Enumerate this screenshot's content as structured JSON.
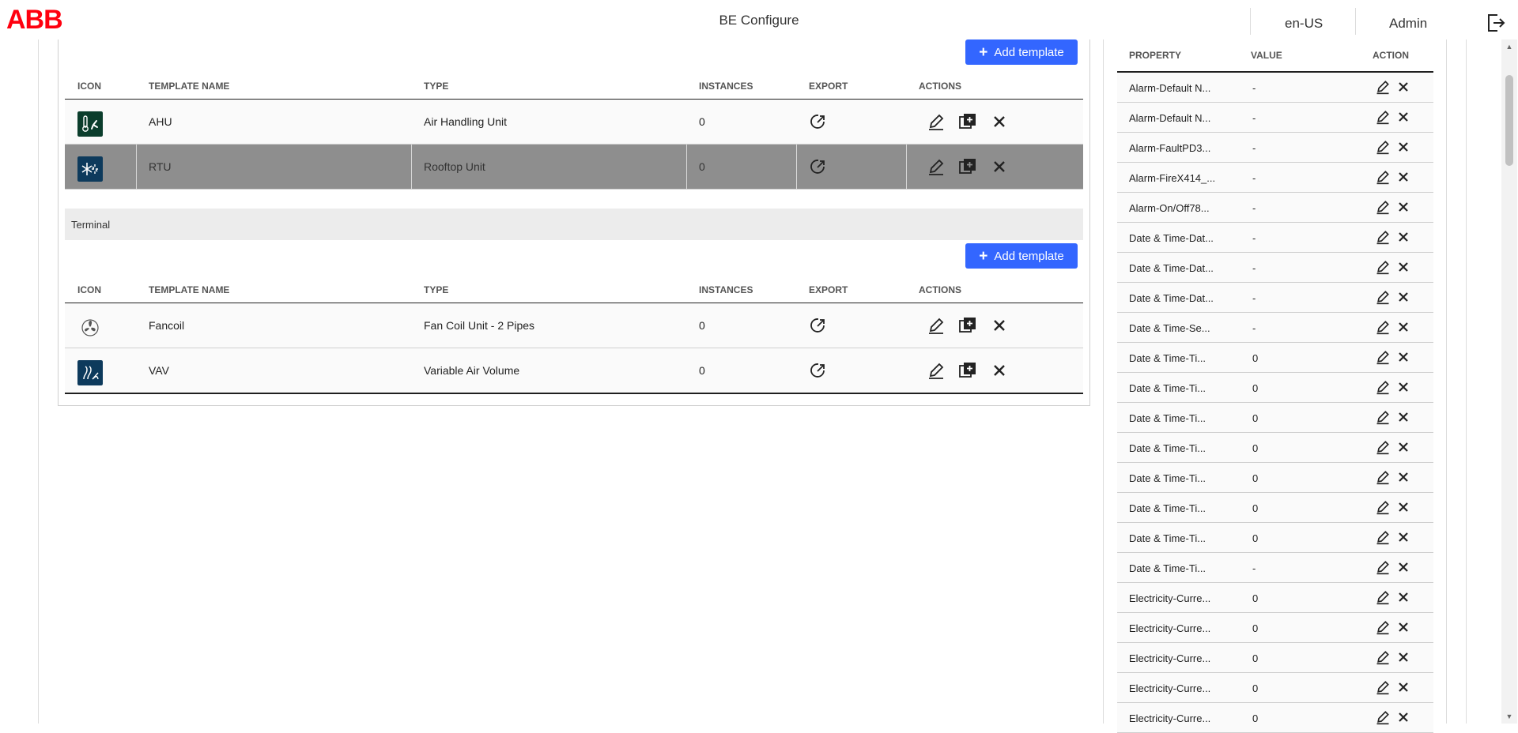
{
  "header": {
    "brand": "ABB",
    "app_title": "BE Configure",
    "language": "en-US",
    "user": "Admin"
  },
  "main": {
    "add_template_label": "Add template",
    "columns": {
      "icon": "ICON",
      "template_name": "TEMPLATE NAME",
      "type": "TYPE",
      "instances": "INSTANCES",
      "export": "EXPORT",
      "actions": "ACTIONS"
    },
    "groups": [
      {
        "name": "",
        "rows": [
          {
            "name": "AHU",
            "type": "Air Handling Unit",
            "instances": "0",
            "icon": "ahu-thermometer-fan-icon",
            "icon_color": "#0b3d2c",
            "selected": false
          },
          {
            "name": "RTU",
            "type": "Rooftop Unit",
            "instances": "0",
            "icon": "rtu-snowflake-sun-icon",
            "icon_color": "#0d3a5c",
            "selected": true
          }
        ]
      },
      {
        "name": "Terminal",
        "rows": [
          {
            "name": "Fancoil",
            "type": "Fan Coil Unit - 2 Pipes",
            "instances": "0",
            "icon": "fan-icon",
            "icon_color": "#ffffff",
            "selected": false
          },
          {
            "name": "VAV",
            "type": "Variable Air Volume",
            "instances": "0",
            "icon": "vav-airflow-icon",
            "icon_color": "#0d3a5c",
            "selected": false
          }
        ]
      }
    ]
  },
  "properties": {
    "columns": {
      "property": "PROPERTY",
      "value": "VALUE",
      "action": "ACTION"
    },
    "rows": [
      {
        "property": "Alarm-Default N...",
        "value": "-"
      },
      {
        "property": "Alarm-Default N...",
        "value": "-"
      },
      {
        "property": "Alarm-FaultPD3...",
        "value": "-"
      },
      {
        "property": "Alarm-FireX414_...",
        "value": "-"
      },
      {
        "property": "Alarm-On/Off78...",
        "value": "-"
      },
      {
        "property": "Date & Time-Dat...",
        "value": "-"
      },
      {
        "property": "Date & Time-Dat...",
        "value": "-"
      },
      {
        "property": "Date & Time-Dat...",
        "value": "-"
      },
      {
        "property": "Date & Time-Se...",
        "value": "-"
      },
      {
        "property": "Date & Time-Ti...",
        "value": "0"
      },
      {
        "property": "Date & Time-Ti...",
        "value": "0"
      },
      {
        "property": "Date & Time-Ti...",
        "value": "0"
      },
      {
        "property": "Date & Time-Ti...",
        "value": "0"
      },
      {
        "property": "Date & Time-Ti...",
        "value": "0"
      },
      {
        "property": "Date & Time-Ti...",
        "value": "0"
      },
      {
        "property": "Date & Time-Ti...",
        "value": "0"
      },
      {
        "property": "Date & Time-Ti...",
        "value": "-"
      },
      {
        "property": "Electricity-Curre...",
        "value": "0"
      },
      {
        "property": "Electricity-Curre...",
        "value": "0"
      },
      {
        "property": "Electricity-Curre...",
        "value": "0"
      },
      {
        "property": "Electricity-Curre...",
        "value": "0"
      },
      {
        "property": "Electricity-Curre...",
        "value": "0"
      }
    ]
  },
  "colors": {
    "brand_red": "#ff000f",
    "accent_blue": "#3366ff",
    "selected_row": "#8e8e8e"
  }
}
